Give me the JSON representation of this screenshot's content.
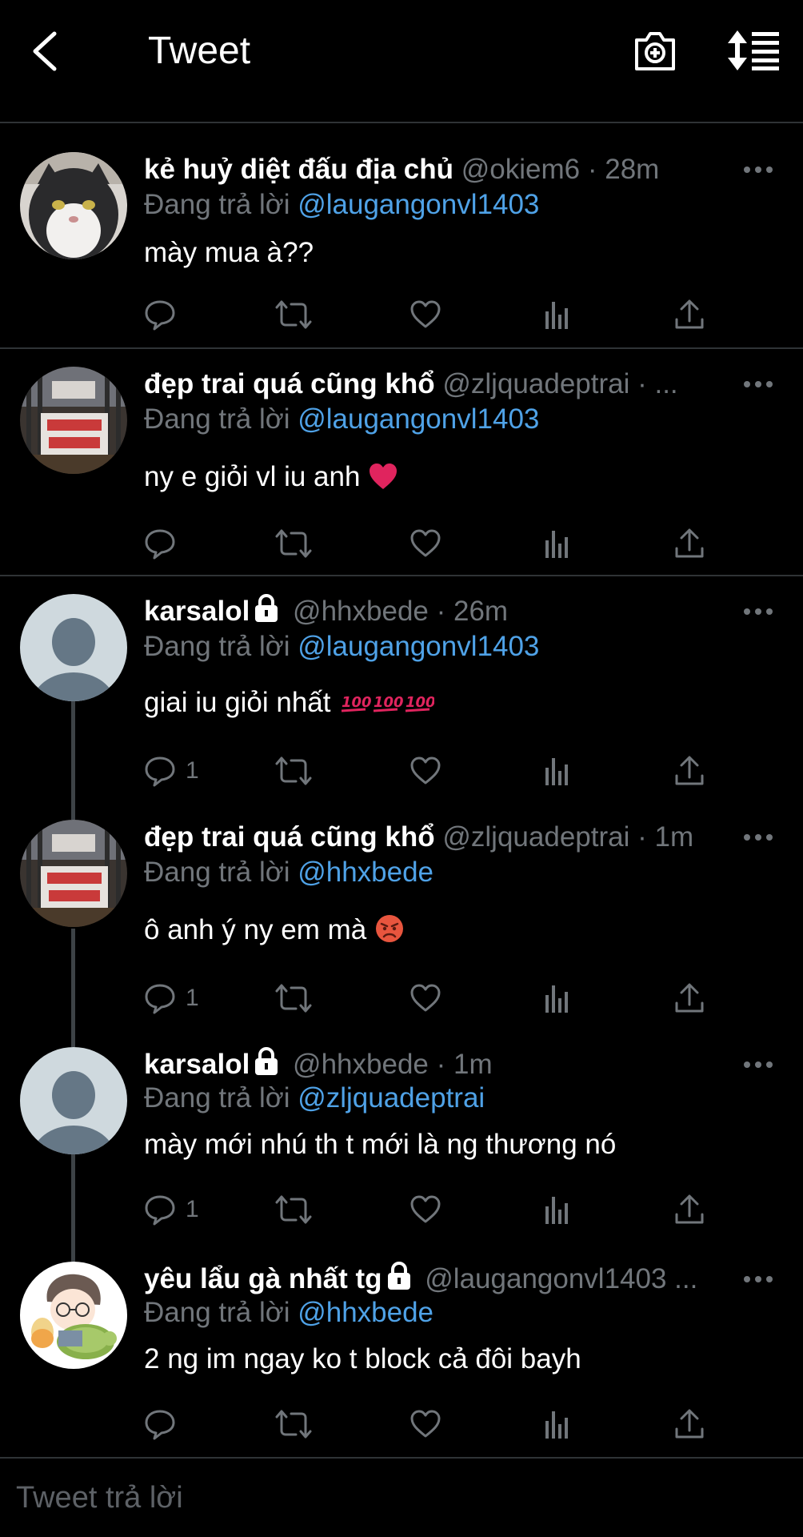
{
  "header": {
    "back_icon": "chevron-left-icon",
    "title": "Tweet",
    "camera_icon": "camera-plus-icon",
    "sort_icon": "sort-lines-icon"
  },
  "colors": {
    "background": "#000000",
    "text": "#ffffff",
    "secondary": "#71767b",
    "mention": "#4fa2e7",
    "divider": "#2f3336"
  },
  "tweets": [
    {
      "display_name": "kẻ huỷ diệt đấu địa chủ",
      "handle_time": "@okiem6 · 28m",
      "reply_label": "Đang trả lời",
      "reply_to": "@laugangonvl1403",
      "text": "mày mua à??",
      "reply_count": "",
      "avatar": "cat-avatar",
      "locked": false
    },
    {
      "display_name": "đẹp trai quá cũng khổ",
      "handle_time": "@zljquadeptrai · ...",
      "reply_label": "Đang trả lời",
      "reply_to": "@laugangonvl1403",
      "text": "ny e giỏi vl iu anh",
      "emoji": "red-heart-emoji",
      "reply_count": "",
      "avatar": "sign-photo-avatar",
      "locked": false
    },
    {
      "display_name": "karsalol",
      "handle_time": "@hhxbede · 26m",
      "reply_label": "Đang trả lời",
      "reply_to": "@laugangonvl1403",
      "text": "giai iu giỏi nhất",
      "emoji": "hundred-points-emoji",
      "reply_count": "1",
      "avatar": "default-avatar",
      "locked": true
    },
    {
      "display_name": "đẹp trai quá cũng khổ",
      "handle_time": "@zljquadeptrai · 1m",
      "reply_label": "Đang trả lời",
      "reply_to": "@hhxbede",
      "text": "ô anh ý ny em mà",
      "emoji": "angry-face-emoji",
      "reply_count": "1",
      "avatar": "sign-photo-avatar",
      "locked": false
    },
    {
      "display_name": "karsalol",
      "handle_time": "@hhxbede · 1m",
      "reply_label": "Đang trả lời",
      "reply_to": "@zljquadeptrai",
      "text": "mày mới nhú th t mới là ng thương nó",
      "reply_count": "1",
      "avatar": "default-avatar",
      "locked": true
    },
    {
      "display_name": "yêu lẩu gà nhất tg",
      "handle_time": "@laugangonvl1403 ...",
      "reply_label": "Đang trả lời",
      "reply_to": "@hhxbede",
      "text": "2 ng im ngay ko t block cả đôi bayh",
      "reply_count": "",
      "avatar": "cartoon-avatar",
      "locked": true
    }
  ],
  "compose": {
    "placeholder": "Tweet trả lời"
  }
}
